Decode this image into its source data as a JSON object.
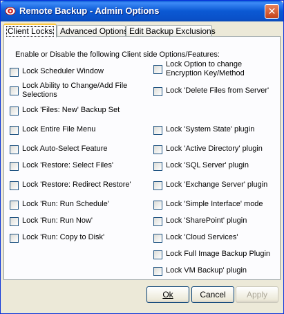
{
  "window": {
    "title": "Remote Backup - Admin Options",
    "close_glyph": "✕"
  },
  "tabs": [
    {
      "label": "Client Locks"
    },
    {
      "label": "Advanced Options"
    },
    {
      "label": "Edit Backup Exclusions"
    }
  ],
  "intro": "Enable or Disable the following Client side Options/Features:",
  "left_options": [
    {
      "label": "Lock Scheduler Window",
      "checked": false
    },
    {
      "label": "Lock Ability to Change/Add File Selections",
      "checked": false
    },
    {
      "label": "Lock 'Files: New' Backup Set",
      "checked": false
    },
    {
      "label": "Lock Entire File Menu",
      "checked": false
    },
    {
      "label": "Lock Auto-Select Feature",
      "checked": false
    },
    {
      "label": "Lock 'Restore: Select Files'",
      "checked": false
    },
    {
      "label": "Lock 'Restore: Redirect Restore'",
      "checked": false
    },
    {
      "label": "Lock 'Run: Run Schedule'",
      "checked": false
    },
    {
      "label": "Lock 'Run: Run Now'",
      "checked": false
    },
    {
      "label": "Lock 'Run: Copy to Disk'",
      "checked": false
    }
  ],
  "right_options": [
    {
      "label": "Lock Option to change Encryption Key/Method",
      "checked": false
    },
    {
      "label": "Lock 'Delete Files from Server'",
      "checked": false
    },
    {
      "label": "Lock 'System State' plugin",
      "checked": false
    },
    {
      "label": "Lock 'Active Directory' plugin",
      "checked": false
    },
    {
      "label": "Lock 'SQL Server' plugin",
      "checked": false
    },
    {
      "label": "Lock 'Exchange Server' plugin",
      "checked": false
    },
    {
      "label": "Lock 'Simple Interface' mode",
      "checked": false
    },
    {
      "label": "Lock 'SharePoint' plugin",
      "checked": false
    },
    {
      "label": "Lock 'Cloud Services'",
      "checked": false
    },
    {
      "label": "Lock Full Image Backup Plugin",
      "checked": false
    },
    {
      "label": "Lock VM Backup' plugin",
      "checked": false
    }
  ],
  "buttons": {
    "ok": "Ok",
    "cancel": "Cancel",
    "apply": "Apply"
  },
  "colors": {
    "titlebar": "#0a5bd6",
    "dialog": "#ece9d8",
    "panel": "#fcfcfe",
    "active_tab_accent": "#ffc83c"
  }
}
